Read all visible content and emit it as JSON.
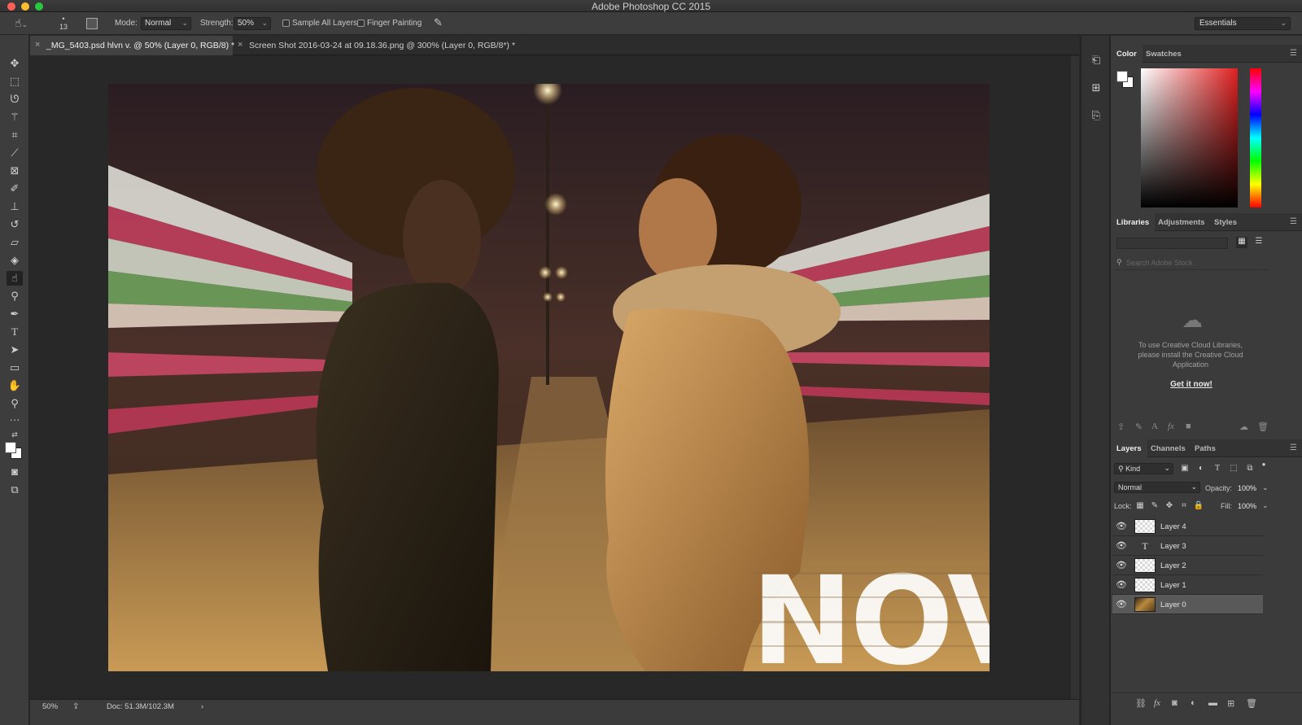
{
  "window": {
    "title": "Adobe Photoshop CC 2015"
  },
  "options_bar": {
    "brush_size": "13",
    "mode_label": "Mode:",
    "mode_value": "Normal",
    "strength_label": "Strength:",
    "strength_value": "50%",
    "sample_all_layers": "Sample All Layers",
    "finger_painting": "Finger Painting",
    "workspace": "Essentials"
  },
  "document_tabs": [
    {
      "label": "_MG_5403.psd hlvn v. @ 50% (Layer 0, RGB/8) *",
      "active": true
    },
    {
      "label": "Screen Shot 2016-03-24 at 09.18.36.png @ 300% (Layer 0, RGB/8*) *",
      "active": false
    }
  ],
  "artwork": {
    "overlay_text": "NOVA"
  },
  "status_bar": {
    "zoom": "50%",
    "doc_info": "Doc: 51.3M/102.3M"
  },
  "color_panel": {
    "tabs": [
      "Color",
      "Swatches"
    ],
    "foreground": "#ffffff",
    "background": "#ffffff",
    "hue": "#e02020"
  },
  "libraries_panel": {
    "tabs": [
      "Libraries",
      "Adjustments",
      "Styles"
    ],
    "search_placeholder": "Search Adobe Stock",
    "message": "To use Creative Cloud Libraries, please install the Creative Cloud Application",
    "link": "Get it now!"
  },
  "layers_panel": {
    "tabs": [
      "Layers",
      "Channels",
      "Paths"
    ],
    "filter_kind": "Kind",
    "blend_mode": "Normal",
    "opacity_label": "Opacity:",
    "opacity_value": "100%",
    "lock_label": "Lock:",
    "fill_label": "Fill:",
    "fill_value": "100%",
    "layers": [
      {
        "name": "Layer 4",
        "visible": true,
        "kind": "pixel",
        "selected": false
      },
      {
        "name": "Layer 3",
        "visible": true,
        "kind": "text",
        "selected": false
      },
      {
        "name": "Layer 2",
        "visible": true,
        "kind": "pixel",
        "selected": false
      },
      {
        "name": "Layer 1",
        "visible": true,
        "kind": "pixel",
        "selected": false
      },
      {
        "name": "Layer 0",
        "visible": true,
        "kind": "photo",
        "selected": true
      }
    ]
  },
  "colors": {
    "panel_bg": "#3b3b3b",
    "canvas_bg": "#282828",
    "accent_hue": "#e02020"
  }
}
